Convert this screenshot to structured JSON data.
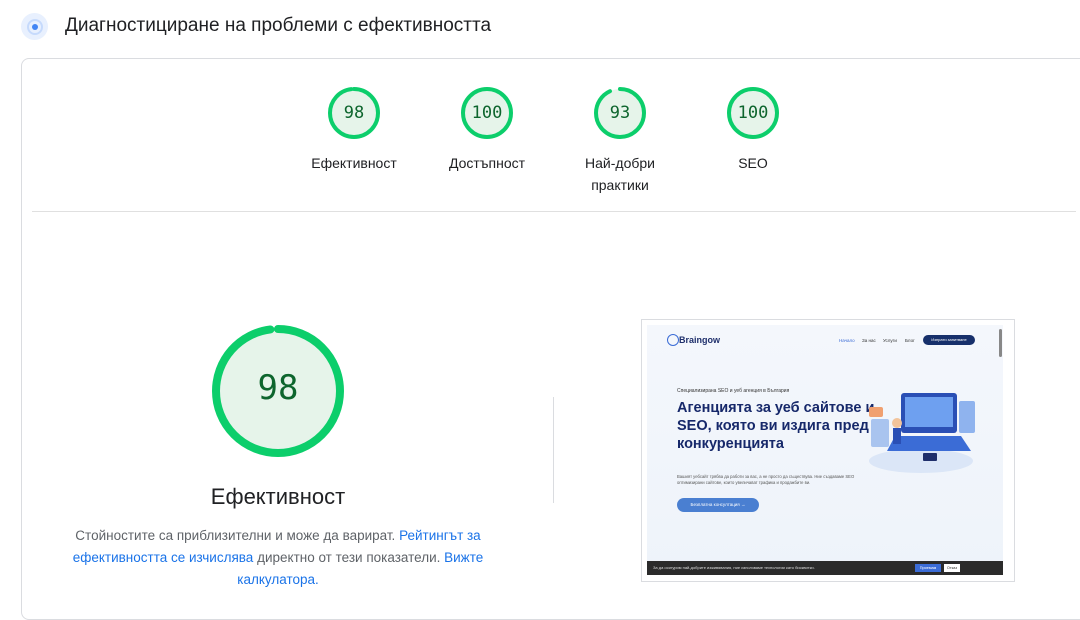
{
  "header": {
    "title": "Диагностициране на проблеми с ефективността",
    "icon": "lighthouse-icon"
  },
  "categories": [
    {
      "score": "98",
      "label": "Ефективност",
      "value": 98
    },
    {
      "score": "100",
      "label": "Достъпност",
      "value": 100
    },
    {
      "score": "93",
      "label": "Най-добри практики",
      "value": 93
    },
    {
      "score": "100",
      "label": "SEO",
      "value": 100
    }
  ],
  "main": {
    "score": "98",
    "value": 98,
    "title": "Ефективност",
    "note_prefix": "Стойностите са приблизителни и може да варират. ",
    "note_link1": "Рейтингът за ефективността се изчислява",
    "note_middle": " директно от тези показатели. ",
    "note_link2": "Вижте калкулатора."
  },
  "thumbnail": {
    "logo": "Braingow",
    "nav": [
      "Начало",
      "За нас",
      "Услуги",
      "Блог"
    ],
    "cta": "Изпрати запитване",
    "kicker": "Специализирана SEO и уеб агенция в България",
    "headline": "Агенцията за уеб сайтове и SEO, която ви издига пред конкуренцията",
    "description": "Вашият уебсайт трябва да работи за вас, а не просто да съществува. Ние създаваме SEO оптимизирани сайтове, които увеличават трафика и продажбите ви.",
    "button": "Безплатна консултация →",
    "cookie_text": "За да осигурим най-добрите изживявания, ние използваме технологии като бисквитки.",
    "cookie_accept": "Приемам",
    "cookie_deny": "Отказ"
  },
  "colors": {
    "gauge_pass": "#0cce6b",
    "gauge_fill": "#e6f4ea",
    "score_text": "#0d652d",
    "link": "#1a73e8"
  }
}
